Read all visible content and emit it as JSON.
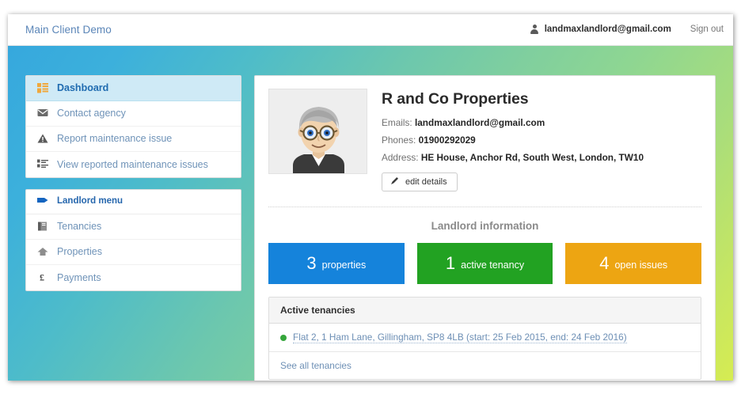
{
  "navbar": {
    "brand": "Main Client Demo",
    "user_email": "landmaxlandlord@gmail.com",
    "sign_out": "Sign out"
  },
  "sidebar": {
    "primary": [
      {
        "label": "Dashboard",
        "icon": "dashboard-grid-icon",
        "active": true
      },
      {
        "label": "Contact agency",
        "icon": "envelope-icon",
        "active": false
      },
      {
        "label": "Report maintenance issue",
        "icon": "warning-triangle-icon",
        "active": false
      },
      {
        "label": "View reported maintenance issues",
        "icon": "list-icon",
        "active": false
      }
    ],
    "secondary_header": {
      "label": "Landlord menu",
      "icon": "tag-icon"
    },
    "secondary": [
      {
        "label": "Tenancies",
        "icon": "book-icon"
      },
      {
        "label": "Properties",
        "icon": "home-icon"
      },
      {
        "label": "Payments",
        "icon": "pound-icon"
      }
    ]
  },
  "profile": {
    "name": "R and Co Properties",
    "emails_label": "Emails:",
    "emails_value": "landmaxlandlord@gmail.com",
    "phones_label": "Phones:",
    "phones_value": "01900292029",
    "address_label": "Address:",
    "address_value": "HE House, Anchor Rd, South West, London, TW10",
    "edit_button": "edit details",
    "edit_icon": "pencil-icon",
    "avatar": "user-avatar-illustration"
  },
  "landlord_info": {
    "section_title": "Landlord information",
    "stats": [
      {
        "number": "3",
        "label": "properties",
        "color": "#1583db"
      },
      {
        "number": "1",
        "label": "active tenancy",
        "color": "#22a222"
      },
      {
        "number": "4",
        "label": "open issues",
        "color": "#eda512"
      }
    ]
  },
  "tenancies": {
    "panel_title": "Active tenancies",
    "rows": [
      {
        "status": "active",
        "text": "Flat 2, 1 Ham Lane, Gillingham, SP8 4LB (start: 25 Feb 2015, end: 24 Feb 2016)"
      }
    ],
    "see_all": "See all tenancies"
  },
  "theme": {
    "gradient_start": "#36a8dd",
    "gradient_mid": "#80cf9e",
    "gradient_end": "#d6ec52",
    "active_menu_bg": "#cfeaf6",
    "link_color": "#6d8fb5"
  }
}
